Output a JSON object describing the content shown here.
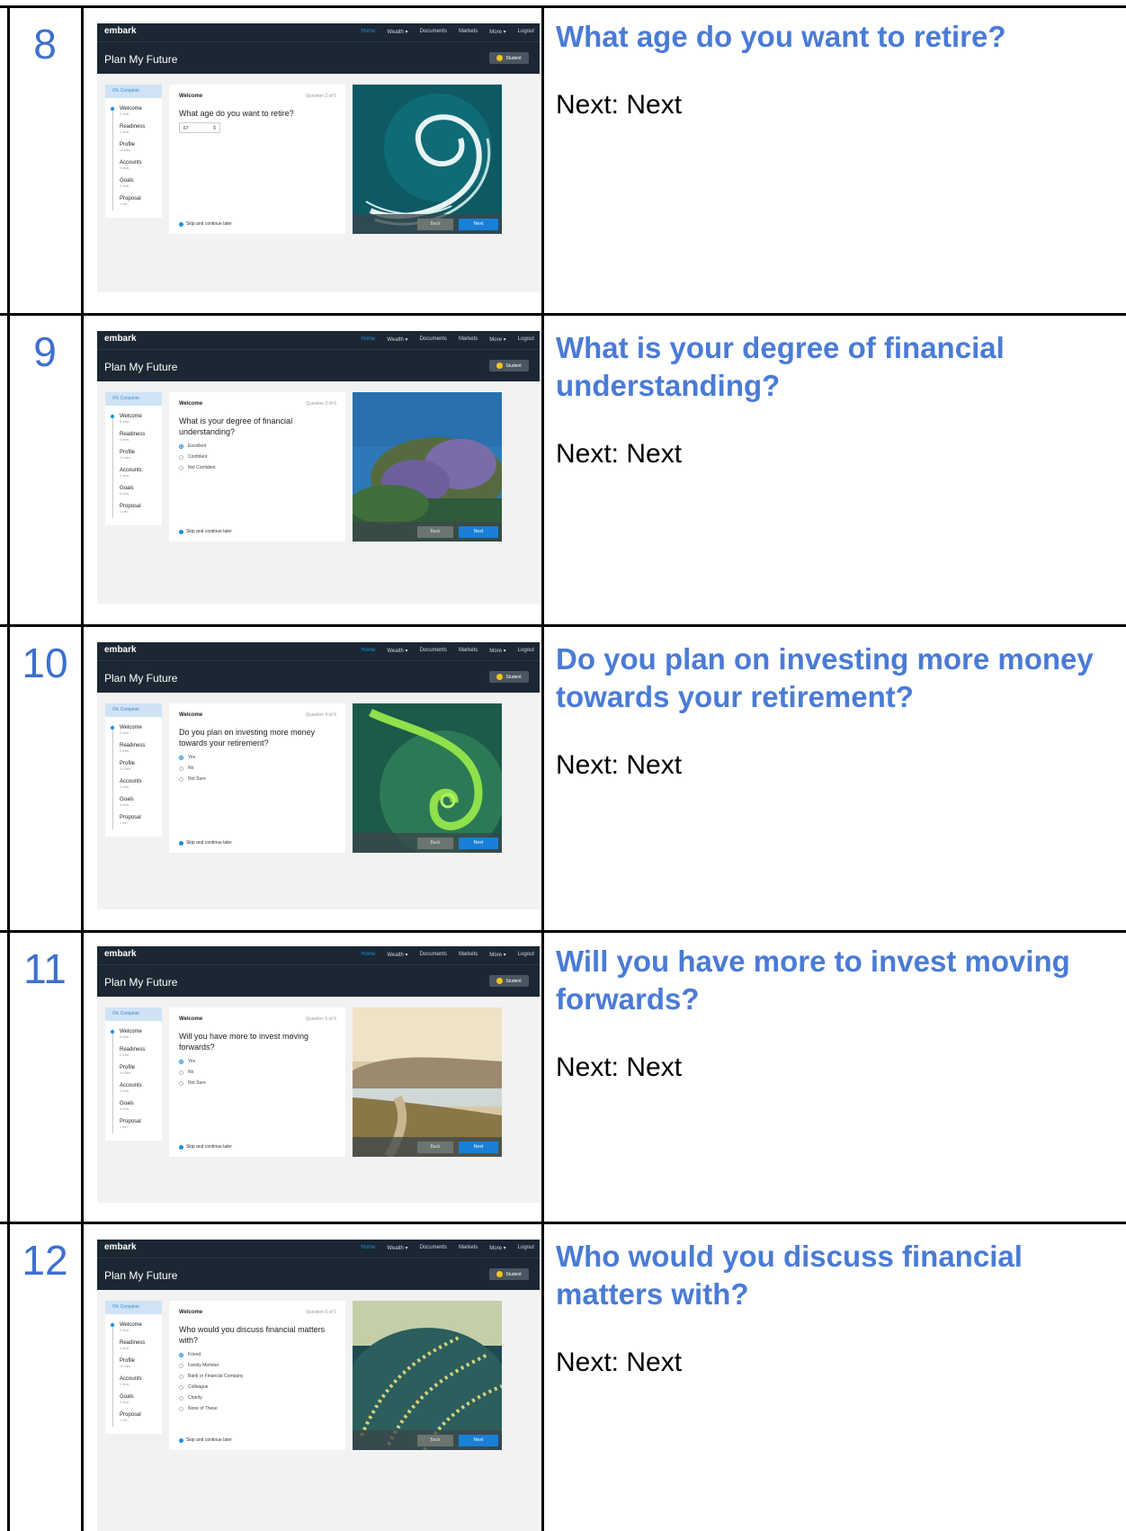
{
  "app": {
    "logo": "embark",
    "nav": [
      "Home",
      "Wealth ▾",
      "Documents",
      "Markets",
      "More ▾",
      "Logout"
    ],
    "page_title": "Plan My Future",
    "user_badge": "Student",
    "progress": "0% Complete",
    "steps": [
      {
        "label": "Welcome",
        "duration": "5 mins"
      },
      {
        "label": "Readiness",
        "duration": "5 mins"
      },
      {
        "label": "Profile",
        "duration": "10 mins"
      },
      {
        "label": "Accounts",
        "duration": "5 mins"
      },
      {
        "label": "Goals",
        "duration": "5 mins"
      },
      {
        "label": "Proposal",
        "duration": "1 min"
      }
    ],
    "section": "Welcome",
    "skip": "Skip and continue later",
    "back": "Back",
    "next": "Next"
  },
  "rows": [
    {
      "number": "8",
      "counter": "Question 2 of 6",
      "question": "What age do you want to retire?",
      "age_value": "67",
      "options": [],
      "heading": "What age do you want to retire?",
      "note": "Next: Next"
    },
    {
      "number": "9",
      "counter": "Question 3 of 6",
      "question": "What is your degree of financial understanding?",
      "options": [
        "Excellent",
        "Confident",
        "Not Confident"
      ],
      "heading": "What is your degree of financial understanding?",
      "note": "Next: Next"
    },
    {
      "number": "10",
      "counter": "Question 4 of 6",
      "question": "Do you plan on investing more money towards your retirement?",
      "options": [
        "Yes",
        "No",
        "Not Sure"
      ],
      "heading": "Do you plan on investing more money towards your retirement?",
      "note": "Next: Next"
    },
    {
      "number": "11",
      "counter": "Question 5 of 6",
      "question": "Will you have more to invest moving forwards?",
      "options": [
        "Yes",
        "No",
        "Not Sure"
      ],
      "heading": "Will you have more to invest moving forwards?",
      "note": "Next: Next"
    },
    {
      "number": "12",
      "counter": "Question 6 of 6",
      "question": "Who would you discuss financial matters with?",
      "options": [
        "Friend",
        "Family Member",
        "Bank or Financial Company",
        "Colleague",
        "Charity",
        "None of These"
      ],
      "heading": "Who would you discuss financial matters with?",
      "note": "Next: Next"
    }
  ],
  "colors": {
    "accent": "#4a7bd6",
    "app_header": "#1b2733",
    "primary_button": "#1a7fd6"
  }
}
